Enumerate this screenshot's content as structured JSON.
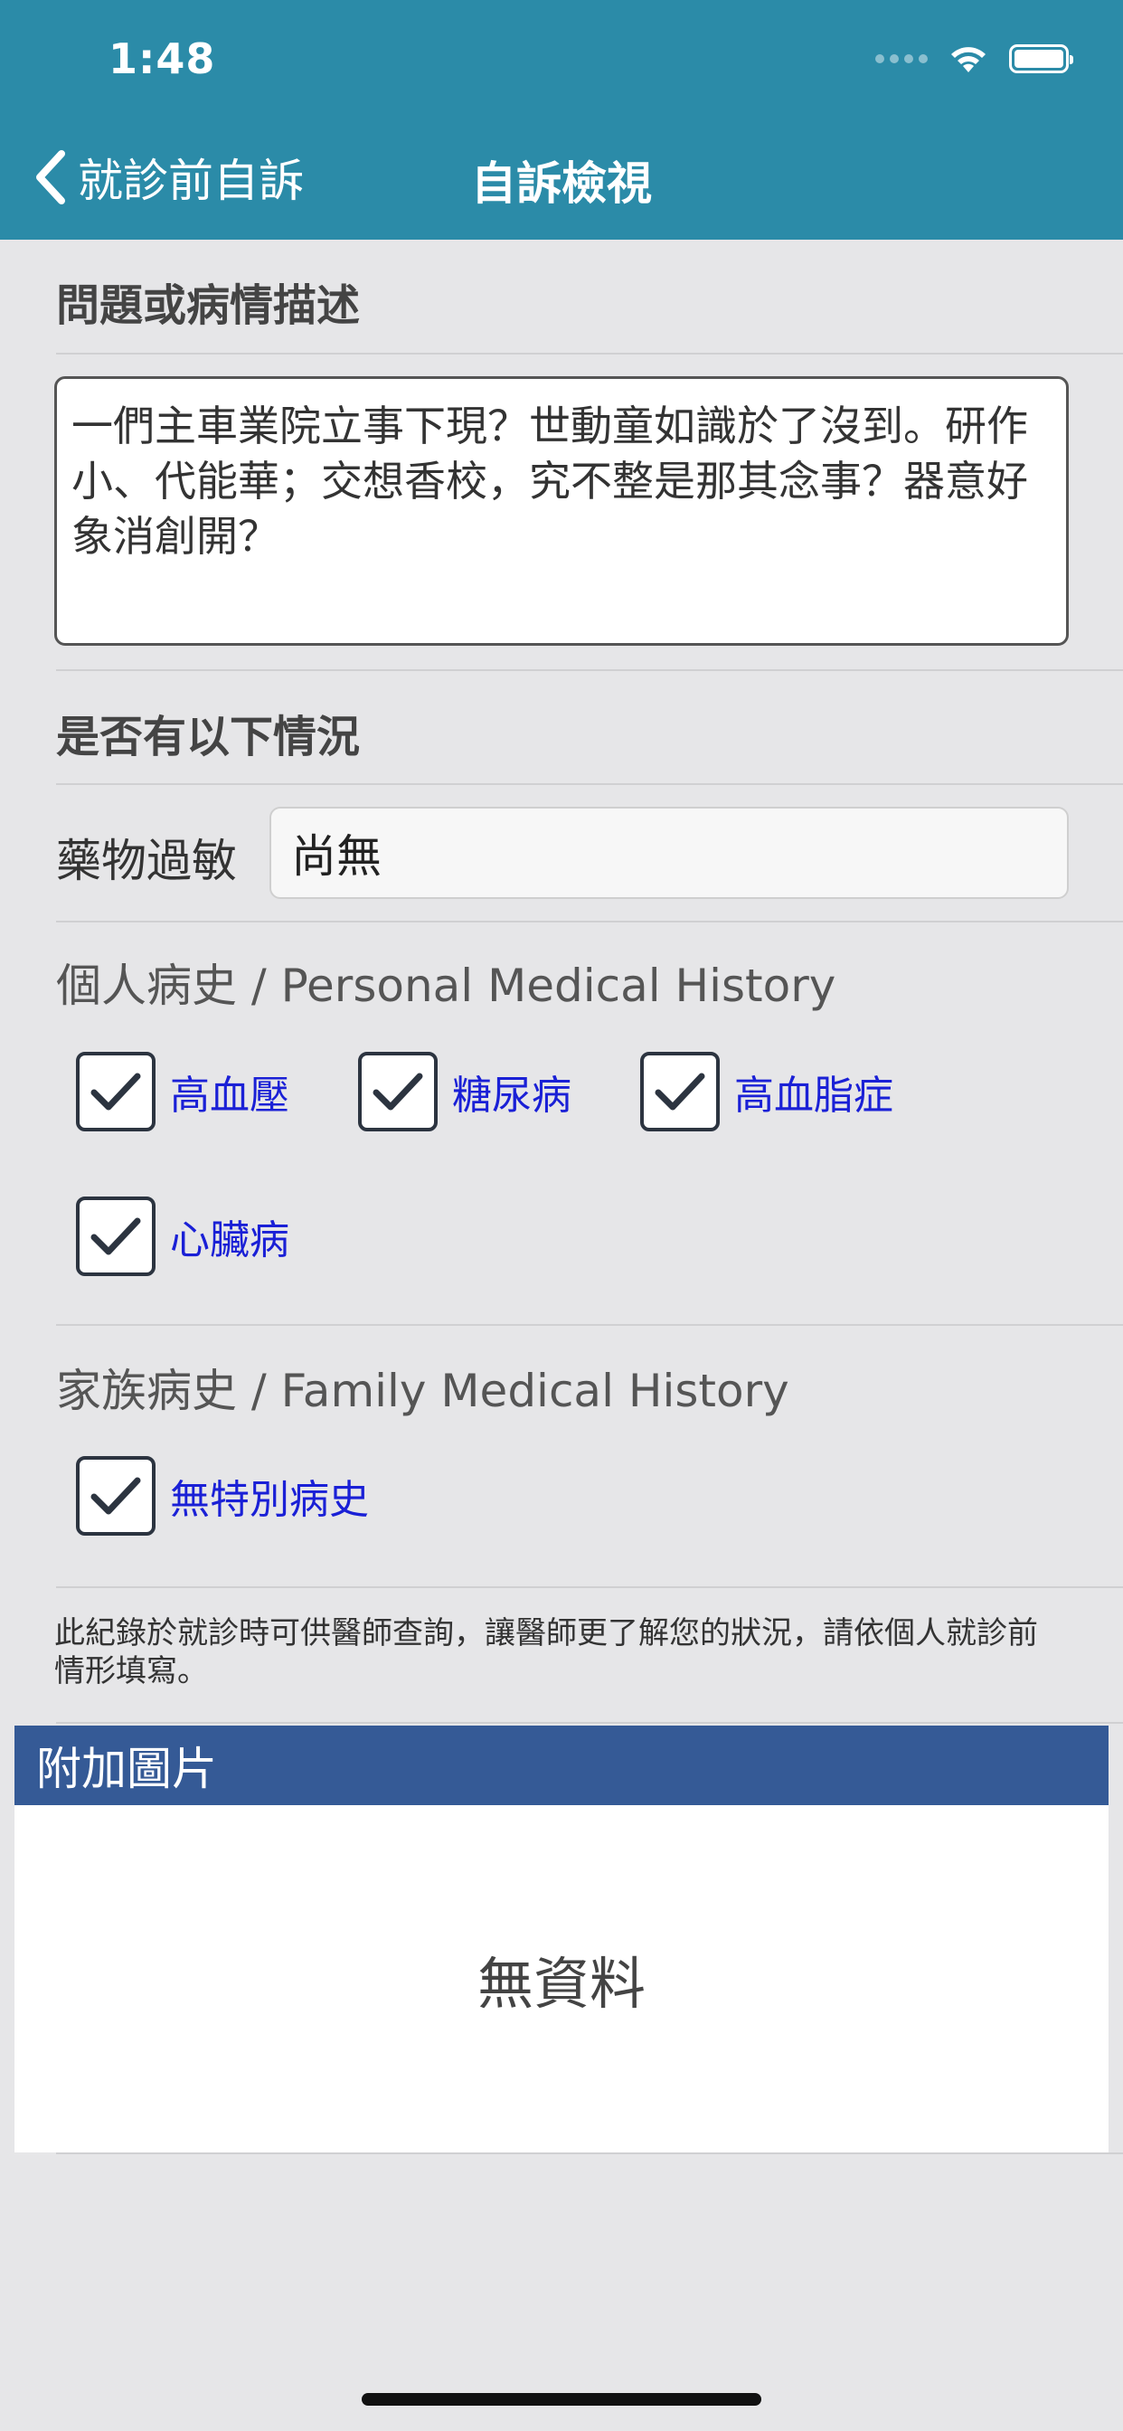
{
  "status_bar": {
    "time": "1:48"
  },
  "nav": {
    "back_label": "就診前自訴",
    "title": "自訴檢視"
  },
  "complaint": {
    "label": "問題或病情描述",
    "text": "一們主車業院立事下現？世動童如識於了沒到。研作小、代能華；交想香校，究不整是那其念事？器意好象消創開？"
  },
  "conditions": {
    "label": "是否有以下情況"
  },
  "allergy": {
    "label": "藥物過敏",
    "value": "尚無"
  },
  "personal_history": {
    "label": "個人病史 / Personal Medical History",
    "items": [
      {
        "label": "高血壓",
        "checked": true
      },
      {
        "label": "糖尿病",
        "checked": true
      },
      {
        "label": "高血脂症",
        "checked": true
      },
      {
        "label": "心臟病",
        "checked": true
      }
    ]
  },
  "family_history": {
    "label": "家族病史 / Family Medical History",
    "items": [
      {
        "label": "無特別病史",
        "checked": true
      }
    ]
  },
  "note": "此紀錄於就診時可供醫師查詢，讓醫師更了解您的狀況，請依個人就診前情形填寫。",
  "attachments": {
    "label": "附加圖片",
    "empty_text": "無資料"
  },
  "colors": {
    "header": "#2b8ba8",
    "attach_header": "#355a96",
    "checkbox_label": "#1a20d6",
    "background": "#e6e6e8"
  }
}
